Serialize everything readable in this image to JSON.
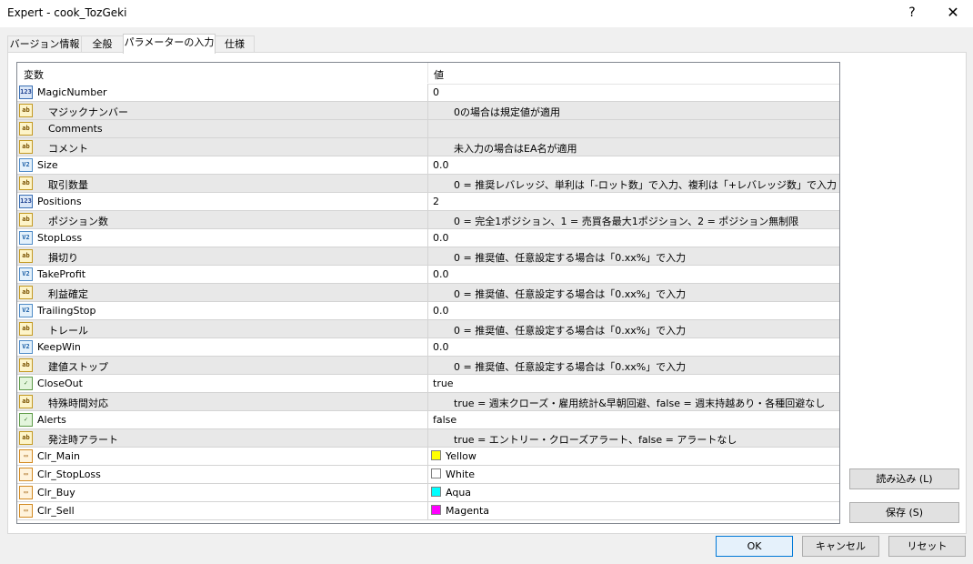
{
  "window": {
    "title": "Expert - cook_TozGeki",
    "help": "?",
    "close": "✕"
  },
  "tabs": [
    {
      "label": "バージョン情報"
    },
    {
      "label": "全般"
    },
    {
      "label": "パラメーターの入力"
    },
    {
      "label": "仕様"
    }
  ],
  "grid": {
    "col_variable": "変数",
    "col_value": "値",
    "rows": [
      {
        "type": "int",
        "badge": "123",
        "name": "MagicNumber",
        "value": "0"
      },
      {
        "type": "str",
        "badge": "ab",
        "name": "マジックナンバー",
        "value": "0の場合は規定値が適用"
      },
      {
        "type": "str",
        "badge": "ab",
        "name": "Comments",
        "value": ""
      },
      {
        "type": "str",
        "badge": "ab",
        "name": "コメント",
        "value": "未入力の場合はEA名が適用"
      },
      {
        "type": "dbl",
        "badge": "V2",
        "name": "Size",
        "value": "0.0"
      },
      {
        "type": "str",
        "badge": "ab",
        "name": "取引数量",
        "value": "0 = 推奨レバレッジ、単利は「-ロット数」で入力、複利は「+レバレッジ数」で入力"
      },
      {
        "type": "int",
        "badge": "123",
        "name": "Positions",
        "value": "2"
      },
      {
        "type": "str",
        "badge": "ab",
        "name": "ポジション数",
        "value": "0 = 完全1ポジション、1 = 売買各最大1ポジション、2 = ポジション無制限"
      },
      {
        "type": "dbl",
        "badge": "V2",
        "name": "StopLoss",
        "value": "0.0"
      },
      {
        "type": "str",
        "badge": "ab",
        "name": "損切り",
        "value": "0 = 推奨値、任意設定する場合は「0.xx%」で入力"
      },
      {
        "type": "dbl",
        "badge": "V2",
        "name": "TakeProfit",
        "value": "0.0"
      },
      {
        "type": "str",
        "badge": "ab",
        "name": "利益確定",
        "value": "0 = 推奨値、任意設定する場合は「0.xx%」で入力"
      },
      {
        "type": "dbl",
        "badge": "V2",
        "name": "TrailingStop",
        "value": "0.0"
      },
      {
        "type": "str",
        "badge": "ab",
        "name": "トレール",
        "value": "0 = 推奨値、任意設定する場合は「0.xx%」で入力"
      },
      {
        "type": "dbl",
        "badge": "V2",
        "name": "KeepWin",
        "value": "0.0"
      },
      {
        "type": "str",
        "badge": "ab",
        "name": "建値ストップ",
        "value": "0 = 推奨値、任意設定する場合は「0.xx%」で入力"
      },
      {
        "type": "bool",
        "badge": "✓",
        "name": "CloseOut",
        "value": "true"
      },
      {
        "type": "str",
        "badge": "ab",
        "name": "特殊時間対応",
        "value": "true = 週末クローズ・雇用統計&早朝回避、false = 週末持越あり・各種回避なし"
      },
      {
        "type": "bool",
        "badge": "✓",
        "name": "Alerts",
        "value": "false"
      },
      {
        "type": "str",
        "badge": "ab",
        "name": "発注時アラート",
        "value": "true = エントリー・クローズアラート、false = アラートなし"
      },
      {
        "type": "clr",
        "badge": "▭",
        "name": "Clr_Main",
        "value": "Yellow",
        "color": "#ffff00"
      },
      {
        "type": "clr",
        "badge": "▭",
        "name": "Clr_StopLoss",
        "value": "White",
        "color": "#ffffff"
      },
      {
        "type": "clr",
        "badge": "▭",
        "name": "Clr_Buy",
        "value": "Aqua",
        "color": "#00ffff"
      },
      {
        "type": "clr",
        "badge": "▭",
        "name": "Clr_Sell",
        "value": "Magenta",
        "color": "#ff00ff"
      }
    ]
  },
  "buttons": {
    "load": "読み込み (L)",
    "save": "保存 (S)",
    "ok": "OK",
    "cancel": "キャンセル",
    "reset": "リセット"
  }
}
